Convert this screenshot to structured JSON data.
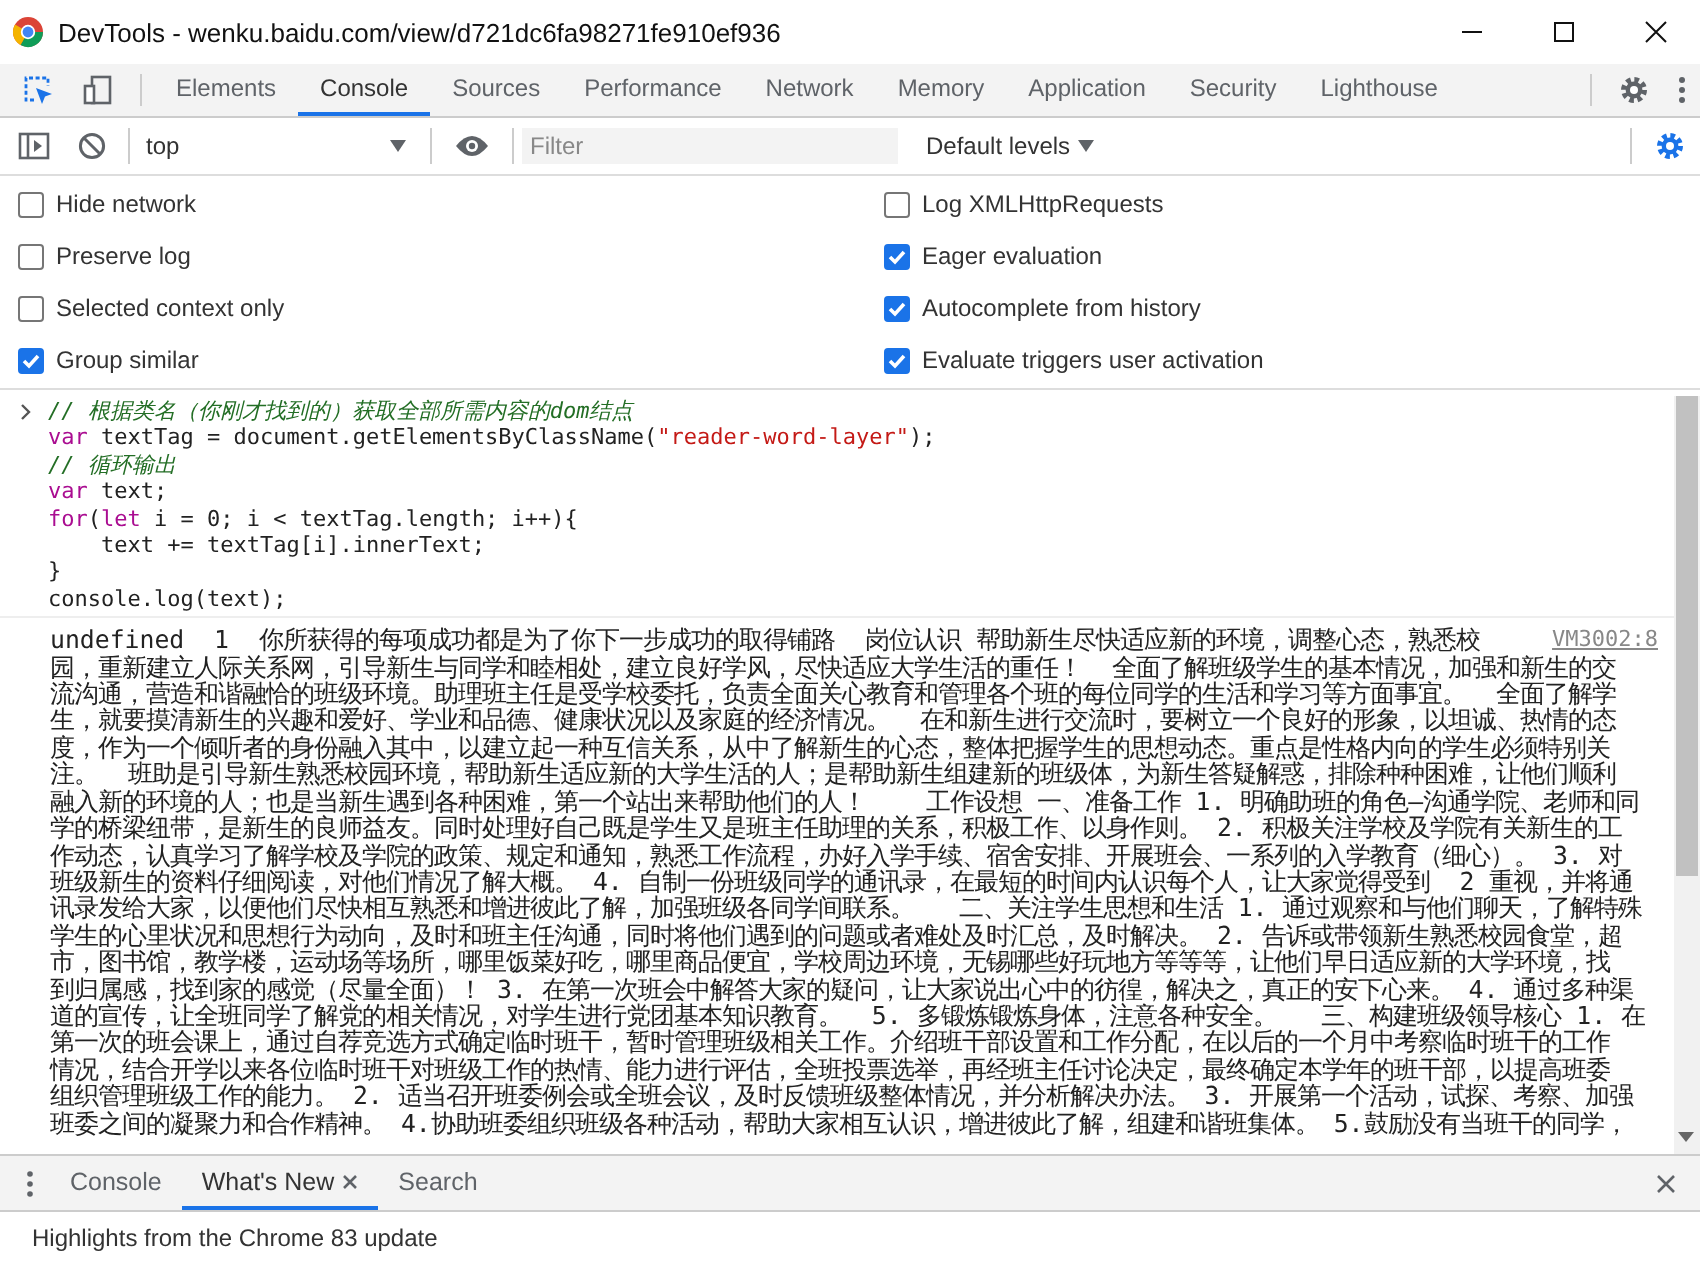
{
  "window": {
    "title": "DevTools - wenku.baidu.com/view/d721dc6fa98271fe910ef936"
  },
  "tabs": [
    {
      "label": "Elements",
      "selected": false
    },
    {
      "label": "Console",
      "selected": true
    },
    {
      "label": "Sources",
      "selected": false
    },
    {
      "label": "Performance",
      "selected": false
    },
    {
      "label": "Network",
      "selected": false
    },
    {
      "label": "Memory",
      "selected": false
    },
    {
      "label": "Application",
      "selected": false
    },
    {
      "label": "Security",
      "selected": false
    },
    {
      "label": "Lighthouse",
      "selected": false
    }
  ],
  "toolbar": {
    "context": "top",
    "filter": {
      "placeholder": "Filter"
    },
    "levels": "Default levels"
  },
  "settings": {
    "left": [
      {
        "label": "Hide network",
        "checked": false
      },
      {
        "label": "Preserve log",
        "checked": false
      },
      {
        "label": "Selected context only",
        "checked": false
      },
      {
        "label": "Group similar",
        "checked": true
      }
    ],
    "right": [
      {
        "label": "Log XMLHttpRequests",
        "checked": false
      },
      {
        "label": "Eager evaluation",
        "checked": true
      },
      {
        "label": "Autocomplete from history",
        "checked": true
      },
      {
        "label": "Evaluate triggers user activation",
        "checked": true
      }
    ]
  },
  "input_code": [
    [
      {
        "kind": "comment",
        "text": "// 根据类名（你刚才找到的）获取全部所需内容的dom结点"
      }
    ],
    [
      {
        "kind": "keyword",
        "text": "var"
      },
      {
        "kind": "plain",
        "text": " textTag = document.getElementsByClassName("
      },
      {
        "kind": "string",
        "text": "\"reader-word-layer\""
      },
      {
        "kind": "plain",
        "text": ");"
      }
    ],
    [
      {
        "kind": "comment",
        "text": "// 循环输出"
      }
    ],
    [
      {
        "kind": "keyword",
        "text": "var"
      },
      {
        "kind": "plain",
        "text": " text;"
      }
    ],
    [
      {
        "kind": "keyword",
        "text": "for"
      },
      {
        "kind": "plain",
        "text": "("
      },
      {
        "kind": "keyword",
        "text": "let"
      },
      {
        "kind": "plain",
        "text": " i = 0; i < textTag.length; i++){"
      }
    ],
    [
      {
        "kind": "plain",
        "text": "    text += textTag[i].innerText;"
      }
    ],
    [
      {
        "kind": "plain",
        "text": "}"
      }
    ],
    [
      {
        "kind": "plain",
        "text": "console.log(text);"
      }
    ]
  ],
  "log": {
    "source": "VM3002:8",
    "lines": [
      "undefined  1  你所获得的每项成功都是为了你下一步成功的取得铺路  岗位认识 帮助新生尽快适应新的环境，调整心态，熟悉校",
      "园，重新建立人际关系网，引导新生与同学和睦相处，建立良好学风，尽快适应大学生活的重任！  全面了解班级学生的基本情况，加强和新生的交",
      "流沟通，营造和谐融恰的班级环境。助理班主任是受学校委托，负责全面关心教育和管理各个班的每位同学的生活和学习等方面事宜。  全面了解学",
      "生，就要摸清新生的兴趣和爱好、学业和品德、健康状况以及家庭的经济情况。  在和新生进行交流时，要树立一个良好的形象，以坦诚、热情的态",
      "度，作为一个倾听者的身份融入其中，以建立起一种互信关系，从中了解新生的心态，整体把握学生的思想动态。重点是性格内向的学生必须特别关",
      "注。  班助是引导新生熟悉校园环境，帮助新生适应新的大学生活的人；是帮助新生组建新的班级体，为新生答疑解惑，排除种种困难，让他们顺利",
      "融入新的环境的人；也是当新生遇到各种困难，第一个站出来帮助他们的人！    工作设想 一、准备工作 1. 明确助班的角色—沟通学院、老师和同",
      "学的桥梁纽带，是新生的良师益友。同时处理好自己既是学生又是班主任助理的关系，积极工作、以身作则。 2. 积极关注学校及学院有关新生的工",
      "作动态，认真学习了解学校及学院的政策、规定和通知，熟悉工作流程，办好入学手续、宿舍安排、开展班会、一系列的入学教育（细心）。 3. 对",
      "班级新生的资料仔细阅读，对他们情况了解大概。 4. 自制一份班级同学的通讯录，在最短的时间内认识每个人，让大家觉得受到  2 重视，并将通",
      "讯录发给大家，以便他们尽快相互熟悉和增进彼此了解，加强班级各同学间联系。   二、关注学生思想和生活 1. 通过观察和与他们聊天，了解特殊",
      "学生的心里状况和思想行为动向，及时和班主任沟通，同时将他们遇到的问题或者难处及时汇总，及时解决。 2. 告诉或带领新生熟悉校园食堂，超",
      "市，图书馆，教学楼，运动场等场所，哪里饭菜好吃，哪里商品便宜，学校周边环境，无锡哪些好玩地方等等等，让他们早日适应新的大学环境，找",
      "到归属感，找到家的感觉（尽量全面）！ 3. 在第一次班会中解答大家的疑问，让大家说出心中的彷徨，解决之，真正的安下心来。 4. 通过多种渠",
      "道的宣传，让全班同学了解党的相关情况，对学生进行党团基本知识教育。  5. 多锻炼锻炼身体，注意各种安全。   三、构建班级领导核心 1. 在",
      "第一次的班会课上，通过自荐竞选方式确定临时班干，暂时管理班级相关工作。介绍班干部设置和工作分配，在以后的一个月中考察临时班干的工作",
      "情况，结合开学以来各位临时班干对班级工作的热情、能力进行评估，全班投票选举，再经班主任讨论决定，最终确定本学年的班干部，以提高班委",
      "组织管理班级工作的能力。 2. 适当召开班委例会或全班会议，及时反馈班级整体情况，并分析解决办法。 3. 开展第一个活动，试探、考察、加强",
      "班委之间的凝聚力和合作精神。 4.协助班委组织班级各种活动，帮助大家相互认识，增进彼此了解，组建和谐班集体。 5.鼓励没有当班干的同学，"
    ]
  },
  "drawer": {
    "tabs": [
      {
        "label": "Console",
        "selected": false,
        "closable": false
      },
      {
        "label": "What's New",
        "selected": true,
        "closable": true
      },
      {
        "label": "Search",
        "selected": false,
        "closable": false
      }
    ],
    "content": "Highlights from the Chrome 83 update"
  }
}
